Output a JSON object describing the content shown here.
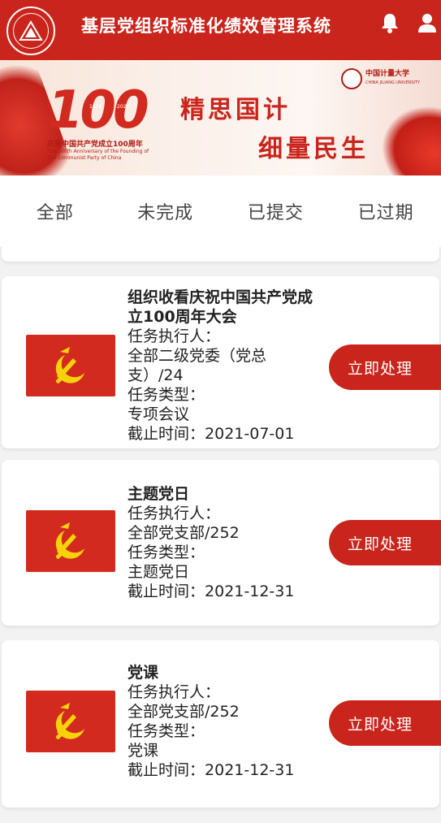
{
  "header": {
    "title": "基层党组织标准化绩效管理系统",
    "icons": [
      "university-logo-icon",
      "bell-icon",
      "user-icon"
    ],
    "color": "#c9251c"
  },
  "banner": {
    "anniversary_number": "100",
    "year_start": "1921",
    "year_end": "2021",
    "anniversary_cn": "庆祝中国共产党成立100周年",
    "anniversary_en": "The 100th Anniversary of the Founding of The Communist Party of China",
    "slogan_line1": "精思国计",
    "slogan_line2": "细量民生",
    "university_name": "中国计量大学",
    "university_en": "CHINA JILIANG UNIVERSITY"
  },
  "tabs": [
    {
      "label": "全部"
    },
    {
      "label": "未完成"
    },
    {
      "label": "已提交"
    },
    {
      "label": "已过期"
    }
  ],
  "tasks": [
    {
      "title": "组织收看庆祝中国共产党成立100周年大会",
      "executor_label": "任务执行人：",
      "executor": "全部二级党委（党总支）/24",
      "type_label": "任务类型：",
      "type": "专项会议",
      "deadline_label": "截止时间：",
      "deadline": "2021-07-01",
      "action": "立即处理"
    },
    {
      "title": "主题党日",
      "executor_label": "任务执行人：",
      "executor": "全部党支部/252",
      "type_label": "任务类型：",
      "type": "主题党日",
      "deadline_label": "截止时间：",
      "deadline": "2021-12-31",
      "action": "立即处理"
    },
    {
      "title": "党课",
      "executor_label": "任务执行人：",
      "executor": "全部党支部/252",
      "type_label": "任务类型：",
      "type": "党课",
      "deadline_label": "截止时间：",
      "deadline": "2021-12-31",
      "action": "立即处理"
    }
  ]
}
